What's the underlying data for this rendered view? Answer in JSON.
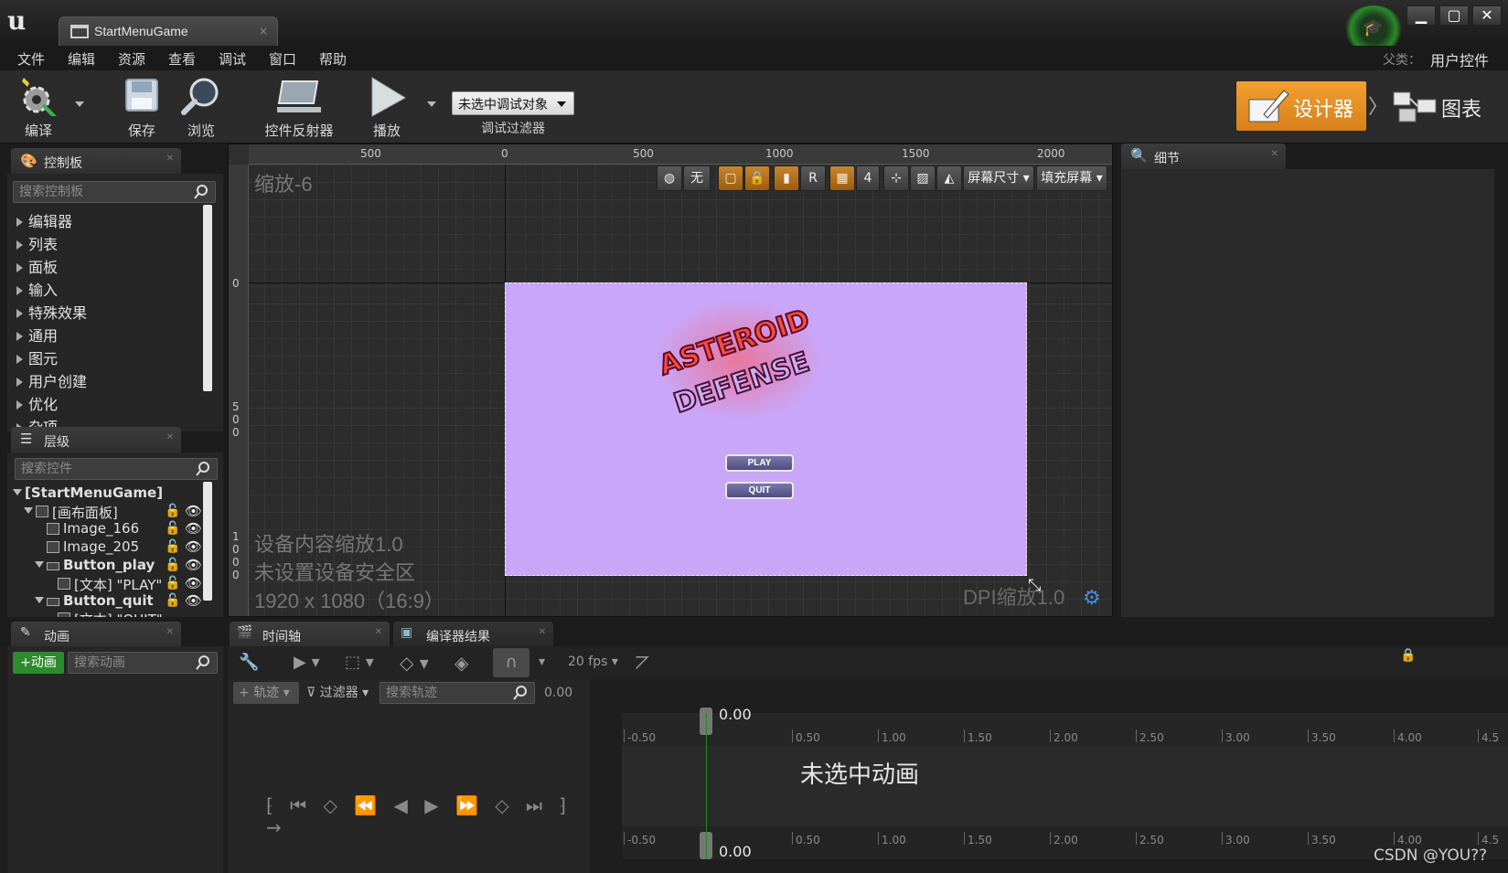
{
  "window": {
    "title_tab": "StartMenuGame",
    "tab_close": "×",
    "minimize": "▁",
    "maximize": "▢",
    "close": "✕"
  },
  "menu": {
    "items": [
      "文件",
      "编辑",
      "资源",
      "查看",
      "调试",
      "窗口",
      "帮助"
    ],
    "parent_label": "父类：",
    "parent_value": "用户控件"
  },
  "toolbar": {
    "compile": "编译",
    "save": "保存",
    "browse": "浏览",
    "widget_reflector": "控件反射器",
    "play": "播放",
    "debug_object": "未选中调试对象",
    "debug_filter": "调试过滤器",
    "designer": "设计器",
    "graph": "图表"
  },
  "palette": {
    "title": "控制板",
    "search_placeholder": "搜索控制板",
    "categories": [
      "编辑器",
      "列表",
      "面板",
      "输入",
      "特殊效果",
      "通用",
      "图元",
      "用户创建",
      "优化",
      "杂项"
    ]
  },
  "hierarchy": {
    "title": "层级",
    "search_placeholder": "搜索控件",
    "rows": [
      {
        "label": "[StartMenuGame]"
      },
      {
        "label": "[画布面板]"
      },
      {
        "label": "Image_166"
      },
      {
        "label": "Image_205"
      },
      {
        "label": "Button_play"
      },
      {
        "label": "[文本] \"PLAY\""
      },
      {
        "label": "Button_quit"
      },
      {
        "label": "[文本] \"QUIT\""
      }
    ]
  },
  "viewport": {
    "zoom": "缩放-6",
    "ruler_top": [
      "500",
      "0",
      "500",
      "1000",
      "1500",
      "2000"
    ],
    "ruler_left": [
      "0",
      "5",
      "0",
      "0",
      "1",
      "0",
      "0",
      "0"
    ],
    "toolbar": {
      "none": "无",
      "r": "R",
      "grid_size": "4",
      "screen_size": "屏幕尺寸",
      "fill_screen": "填充屏幕"
    },
    "info_scale": "设备内容缩放1.0",
    "info_safe_zone": "未设置设备安全区",
    "info_resolution": "1920 x 1080（16:9）",
    "dpi": "DPI缩放1.0",
    "canvas_bg": "#caa6f8",
    "logo_line1": "ASTEROID",
    "logo_line2": "DEFENSE",
    "play_btn": "PLAY",
    "quit_btn": "QUIT"
  },
  "details": {
    "title": "细节"
  },
  "animations": {
    "title": "动画",
    "add": "+动画",
    "search_placeholder": "搜索动画"
  },
  "timeline": {
    "tab": "时间轴",
    "compiler_tab": "编译器结果",
    "fps": "20 fps",
    "tracks_btn": "轨迹",
    "filter_btn": "过滤器",
    "search_placeholder": "搜索轨迹",
    "current_time": "0.00",
    "playhead_time": "0.00",
    "ticks": [
      "-0.50",
      "0.50",
      "1.00",
      "1.50",
      "2.00",
      "2.50",
      "3.00",
      "3.50",
      "4.00",
      "4.5"
    ],
    "no_animation": "未选中动画"
  },
  "watermark": "CSDN @YOU??",
  "colors": {
    "accent": "#e8902a",
    "playhead": "#1c8a1c"
  }
}
